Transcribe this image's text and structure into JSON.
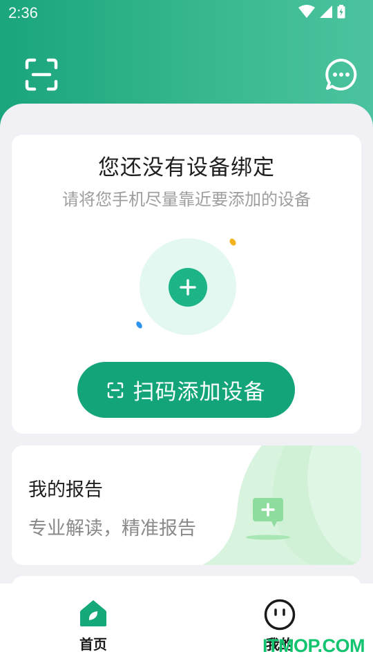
{
  "status_bar": {
    "time": "2:36"
  },
  "colors": {
    "brand": "#1aa57c",
    "accent": "#13a579",
    "plus": "#1db587",
    "halo": "#e3f8f0",
    "watermark": "#12c36f"
  },
  "toolbar": {
    "scan_icon": "scan-icon",
    "message_icon": "chat-bubble-icon"
  },
  "bind_card": {
    "title": "您还没有设备绑定",
    "subtitle": "请将您手机尽量靠近要添加的设备",
    "button_label": "扫码添加设备"
  },
  "report_card": {
    "title": "我的报告",
    "subtitle": "专业解读，精准报告"
  },
  "bottom_nav": {
    "items": [
      {
        "label": "首页",
        "icon": "home-leaf-icon",
        "active": true
      },
      {
        "label": "我的",
        "icon": "face-icon",
        "active": false
      }
    ]
  },
  "watermark": "ITMOP.COM"
}
